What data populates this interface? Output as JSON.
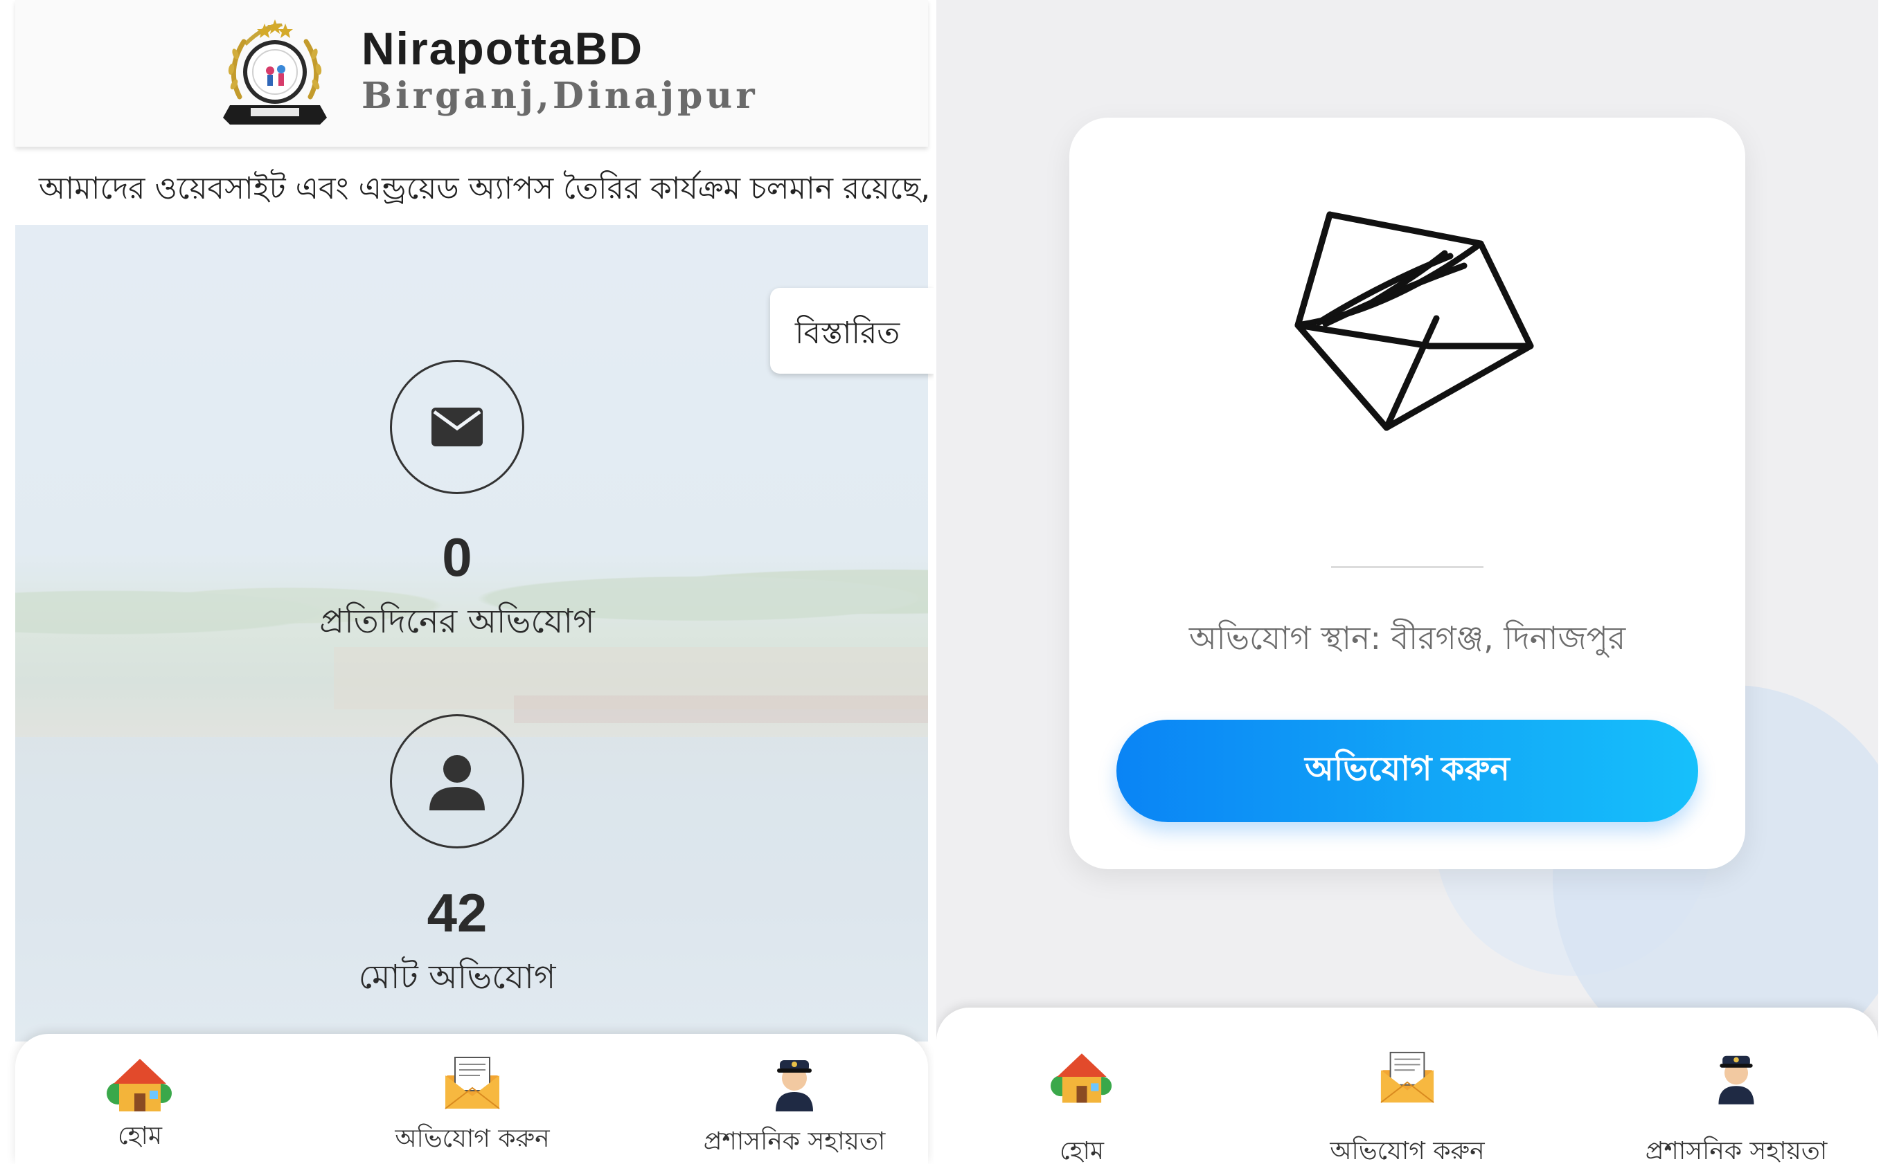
{
  "left": {
    "header": {
      "title": "NirapottaBD",
      "subtitle": "Birganj,Dinajpur"
    },
    "ticker": "আমাদের ওয়েবসাইট এবং এন্ড্রয়েড অ্যাপস তৈরির কার্যক্রম চলমান রয়েছে, অন্",
    "details_tab": "বিস্তারিত",
    "stats": [
      {
        "icon": "envelope-icon",
        "value": "0",
        "label": "প্রতিদিনের অভিযোগ"
      },
      {
        "icon": "user-icon",
        "value": "42",
        "label": "মোট অভিযোগ"
      }
    ],
    "nav": [
      {
        "icon": "house-icon",
        "label": "হোম"
      },
      {
        "icon": "mail-icon",
        "label": "অভিযোগ করুন"
      },
      {
        "icon": "police-officer-icon",
        "label": "প্রশাসনিক সহায়তা"
      }
    ]
  },
  "right": {
    "location_text": "অভিযোগ স্থান: বীরগঞ্জ, দিনাজপুর",
    "cta_label": "অভিযোগ করুন",
    "nav": [
      {
        "icon": "house-icon",
        "label": "হোম"
      },
      {
        "icon": "mail-icon",
        "label": "অভিযোগ করুন"
      },
      {
        "icon": "police-officer-icon",
        "label": "প্রশাসনিক সহায়তা"
      }
    ]
  },
  "colors": {
    "accent_start": "#0a84f5",
    "accent_end": "#16c0fb"
  }
}
